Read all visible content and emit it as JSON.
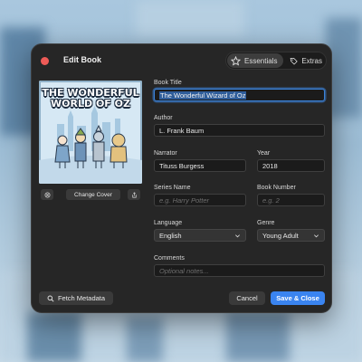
{
  "window": {
    "title": "Edit Book"
  },
  "tabs": [
    {
      "label": "Essentials",
      "icon": "star-icon"
    },
    {
      "label": "Extras",
      "icon": "tag-icon"
    }
  ],
  "cover": {
    "title_line1": "THE WONDERFUL",
    "title_line2": "WORLD OF OZ",
    "change_label": "Change Cover"
  },
  "form": {
    "book_title": {
      "label": "Book Title",
      "value": "The Wonderful Wizard of Oz"
    },
    "author": {
      "label": "Author",
      "value": "L. Frank Baum"
    },
    "narrator": {
      "label": "Narrator",
      "value": "Tituss Burgess"
    },
    "year": {
      "label": "Year",
      "value": "2018"
    },
    "series_name": {
      "label": "Series Name",
      "placeholder": "e.g. Harry Potter"
    },
    "book_number": {
      "label": "Book Number",
      "placeholder": "e.g. 2"
    },
    "language": {
      "label": "Language",
      "value": "English"
    },
    "genre": {
      "label": "Genre",
      "value": "Young Adult"
    },
    "comments": {
      "label": "Comments",
      "placeholder": "Optional notes..."
    }
  },
  "footer": {
    "fetch_label": "Fetch Metadata",
    "cancel_label": "Cancel",
    "save_label": "Save & Close"
  },
  "colors": {
    "accent": "#3a84f0",
    "close": "#ee5b57",
    "dialog_bg": "#262626"
  }
}
